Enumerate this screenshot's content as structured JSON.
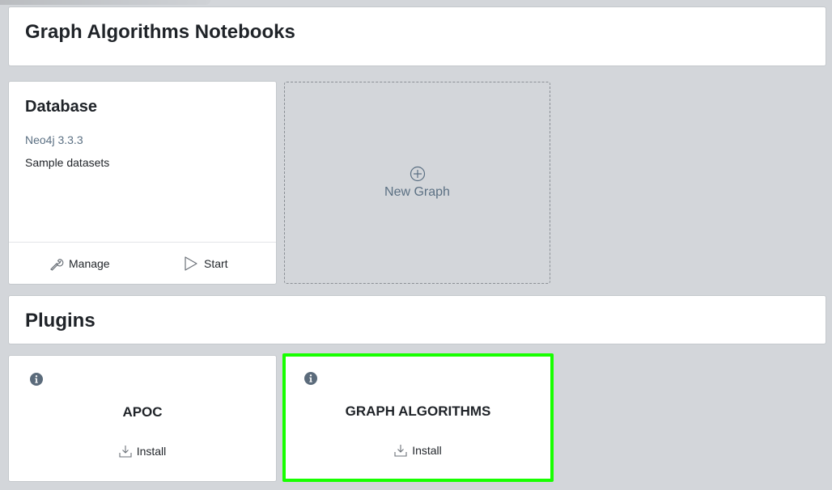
{
  "header": {
    "title": "Graph Algorithms Notebooks"
  },
  "database": {
    "title": "Database",
    "version": "Neo4j 3.3.3",
    "description": "Sample datasets",
    "manage_label": "Manage",
    "start_label": "Start"
  },
  "new_graph": {
    "label": "New Graph",
    "icon": "plus-circle-icon"
  },
  "plugins": {
    "title": "Plugins",
    "items": [
      {
        "name": "APOC",
        "install_label": "Install",
        "info_icon": "info-icon",
        "install_icon": "download-icon"
      },
      {
        "name": "GRAPH ALGORITHMS",
        "install_label": "Install",
        "info_icon": "info-icon",
        "install_icon": "download-icon",
        "highlight_color": "#18ff00"
      }
    ]
  },
  "colors": {
    "background": "#d3d6da",
    "muted_text": "#5b7083",
    "highlight": "#18ff00"
  }
}
